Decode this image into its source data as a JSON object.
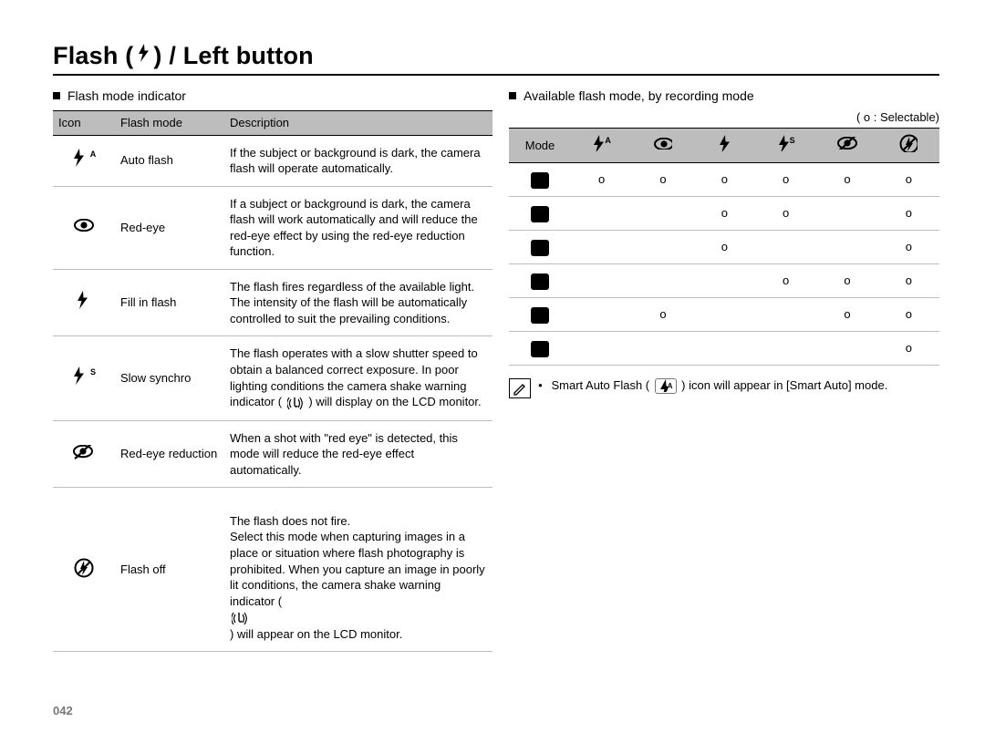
{
  "title_prefix": "Flash (",
  "title_suffix": ") / Left button",
  "page_number": "042",
  "left_section": {
    "heading": "Flash mode indicator",
    "columns": [
      "Icon",
      "Flash mode",
      "Description"
    ],
    "rows": [
      {
        "icon": "flash-auto",
        "mode": "Auto flash",
        "desc": "If the subject or background is dark, the camera flash will operate automatically."
      },
      {
        "icon": "red-eye",
        "mode": "Red-eye",
        "desc": "If a subject or background is dark, the camera flash will work automatically and will reduce the red-eye effect by using the red-eye reduction function."
      },
      {
        "icon": "fill-flash",
        "mode": "Fill in flash",
        "desc": "The flash fires regardless of the available light. The intensity of the flash will be automatically controlled to suit the prevailing conditions."
      },
      {
        "icon": "slow-sync",
        "mode": "Slow synchro",
        "desc_pre": "The flash operates with a slow shutter speed to obtain a balanced correct exposure. In poor lighting conditions the camera shake warning indicator (",
        "desc_post": ") will display on the LCD monitor."
      },
      {
        "icon": "red-eye-reduction",
        "mode": "Red-eye reduction",
        "desc": "When a shot with \"red eye\" is detected, this mode will reduce the red-eye effect automatically."
      },
      {
        "icon": "flash-off",
        "mode": "Flash off",
        "desc_pre": "The flash does not fire.\nSelect this mode when capturing images in a place or situation where flash photography is prohibited. When you capture an image in poorly lit conditions, the camera shake warning indicator (",
        "desc_post": ") will appear on the LCD monitor."
      }
    ]
  },
  "right_section": {
    "heading": "Available flash mode, by recording mode",
    "legend": "( o : Selectable)",
    "header_label": "Mode",
    "col_icons": [
      "flash-auto",
      "red-eye",
      "fill-flash",
      "slow-sync",
      "red-eye-reduction",
      "flash-off"
    ],
    "row_modes": [
      "mode-1",
      "mode-2",
      "mode-3",
      "mode-4",
      "mode-5",
      "mode-6"
    ],
    "matrix": [
      [
        "o",
        "o",
        "o",
        "o",
        "o",
        "o"
      ],
      [
        "",
        "",
        "o",
        "o",
        "",
        "o"
      ],
      [
        "",
        "",
        "o",
        "",
        "",
        "o"
      ],
      [
        "",
        "",
        "",
        "o",
        "o",
        "o"
      ],
      [
        "",
        "o",
        "",
        "",
        "o",
        "o"
      ],
      [
        "",
        "",
        "",
        "",
        "",
        "o"
      ]
    ],
    "note_pre": "Smart Auto Flash (",
    "note_post": ") icon will appear in [Smart Auto] mode."
  }
}
